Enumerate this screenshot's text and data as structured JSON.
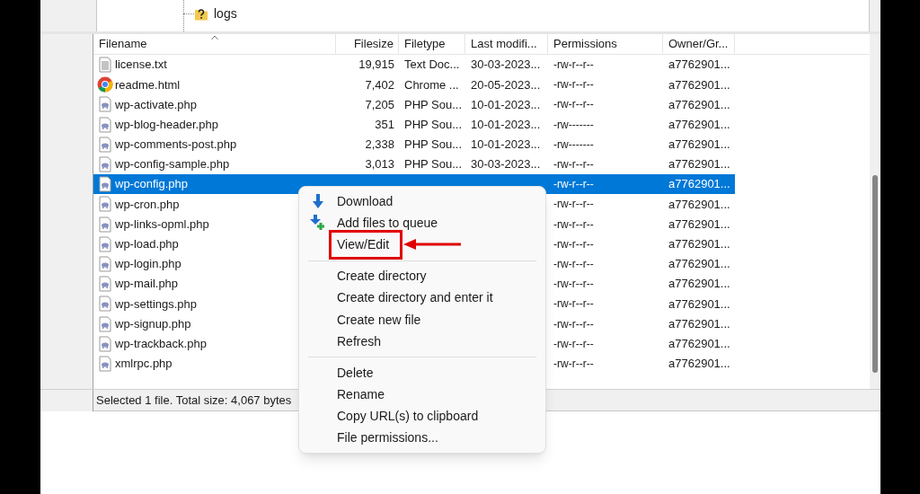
{
  "tree": {
    "items": [
      {
        "label": "logs"
      }
    ]
  },
  "table": {
    "columns": [
      {
        "label": "Filename",
        "sorted": true
      },
      {
        "label": "Filesize",
        "sorted": false
      },
      {
        "label": "Filetype",
        "sorted": false
      },
      {
        "label": "Last modifi...",
        "sorted": false
      },
      {
        "label": "Permissions",
        "sorted": false
      },
      {
        "label": "Owner/Gr...",
        "sorted": false
      }
    ],
    "rows": [
      {
        "kind": "text",
        "selected": false,
        "filename": "license.txt",
        "filesize": "19,915",
        "filetype": "Text Doc...",
        "last_modified": "30-03-2023...",
        "permissions": "-rw-r--r--",
        "owner": "a7762901..."
      },
      {
        "kind": "html",
        "selected": false,
        "filename": "readme.html",
        "filesize": "7,402",
        "filetype": "Chrome ...",
        "last_modified": "20-05-2023...",
        "permissions": "-rw-r--r--",
        "owner": "a7762901..."
      },
      {
        "kind": "php",
        "selected": false,
        "filename": "wp-activate.php",
        "filesize": "7,205",
        "filetype": "PHP Sou...",
        "last_modified": "10-01-2023...",
        "permissions": "-rw-r--r--",
        "owner": "a7762901..."
      },
      {
        "kind": "php",
        "selected": false,
        "filename": "wp-blog-header.php",
        "filesize": "351",
        "filetype": "PHP Sou...",
        "last_modified": "10-01-2023...",
        "permissions": "-rw-------",
        "owner": "a7762901..."
      },
      {
        "kind": "php",
        "selected": false,
        "filename": "wp-comments-post.php",
        "filesize": "2,338",
        "filetype": "PHP Sou...",
        "last_modified": "10-01-2023...",
        "permissions": "-rw-------",
        "owner": "a7762901..."
      },
      {
        "kind": "php",
        "selected": false,
        "filename": "wp-config-sample.php",
        "filesize": "3,013",
        "filetype": "PHP Sou...",
        "last_modified": "30-03-2023...",
        "permissions": "-rw-r--r--",
        "owner": "a7762901..."
      },
      {
        "kind": "php",
        "selected": true,
        "filename": "wp-config.php",
        "permissions": "-rw-r--r--",
        "owner": "a7762901..."
      },
      {
        "kind": "php",
        "selected": false,
        "filename": "wp-cron.php",
        "permissions": "-rw-r--r--",
        "owner": "a7762901..."
      },
      {
        "kind": "php",
        "selected": false,
        "filename": "wp-links-opml.php",
        "permissions": "-rw-r--r--",
        "owner": "a7762901..."
      },
      {
        "kind": "php",
        "selected": false,
        "filename": "wp-load.php",
        "permissions": "-rw-r--r--",
        "owner": "a7762901..."
      },
      {
        "kind": "php",
        "selected": false,
        "filename": "wp-login.php",
        "permissions": "-rw-r--r--",
        "owner": "a7762901..."
      },
      {
        "kind": "php",
        "selected": false,
        "filename": "wp-mail.php",
        "permissions": "-rw-r--r--",
        "owner": "a7762901..."
      },
      {
        "kind": "php",
        "selected": false,
        "filename": "wp-settings.php",
        "permissions": "-rw-r--r--",
        "owner": "a7762901..."
      },
      {
        "kind": "php",
        "selected": false,
        "filename": "wp-signup.php",
        "permissions": "-rw-r--r--",
        "owner": "a7762901..."
      },
      {
        "kind": "php",
        "selected": false,
        "filename": "wp-trackback.php",
        "permissions": "-rw-r--r--",
        "owner": "a7762901..."
      },
      {
        "kind": "php",
        "selected": false,
        "filename": "xmlrpc.php",
        "permissions": "-rw-r--r--",
        "owner": "a7762901..."
      }
    ]
  },
  "status_bar": {
    "text": "Selected 1 file. Total size: 4,067 bytes"
  },
  "context_menu": {
    "groups": [
      [
        {
          "label": "Download",
          "kind": "download",
          "highlighted": false
        },
        {
          "label": "Add files to queue",
          "kind": "queue",
          "highlighted": false
        },
        {
          "label": "View/Edit",
          "highlighted": true
        }
      ],
      [
        {
          "label": "Create directory",
          "highlighted": false
        },
        {
          "label": "Create directory and enter it",
          "highlighted": false
        },
        {
          "label": "Create new file",
          "highlighted": false
        },
        {
          "label": "Refresh",
          "highlighted": false
        }
      ],
      [
        {
          "label": "Delete",
          "highlighted": false
        },
        {
          "label": "Rename",
          "highlighted": false
        },
        {
          "label": "Copy URL(s) to clipboard",
          "highlighted": false
        },
        {
          "label": "File permissions...",
          "highlighted": false
        }
      ]
    ]
  }
}
